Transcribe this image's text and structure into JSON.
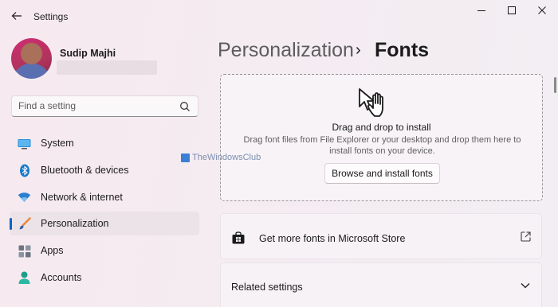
{
  "window": {
    "title": "Settings"
  },
  "user": {
    "name": "Sudip Majhi"
  },
  "search": {
    "placeholder": "Find a setting"
  },
  "sidebar": {
    "items": [
      {
        "label": "System",
        "icon": "monitor-icon"
      },
      {
        "label": "Bluetooth & devices",
        "icon": "bluetooth-icon"
      },
      {
        "label": "Network & internet",
        "icon": "wifi-icon"
      },
      {
        "label": "Personalization",
        "icon": "brush-icon",
        "active": true
      },
      {
        "label": "Apps",
        "icon": "apps-icon"
      },
      {
        "label": "Accounts",
        "icon": "person-icon"
      }
    ]
  },
  "breadcrumb": {
    "parent": "Personalization",
    "separator": "›",
    "current": "Fonts"
  },
  "dropzone": {
    "title": "Drag and drop to install",
    "description": "Drag font files from File Explorer or your desktop and drop them here to install fonts on your device.",
    "browse_label": "Browse and install fonts"
  },
  "store_card": {
    "label": "Get more fonts in Microsoft Store"
  },
  "related": {
    "label": "Related settings"
  },
  "watermark": {
    "text": "TheWindowsClub"
  },
  "colors": {
    "accent": "#0067c0",
    "background": "#f4ecf1"
  }
}
